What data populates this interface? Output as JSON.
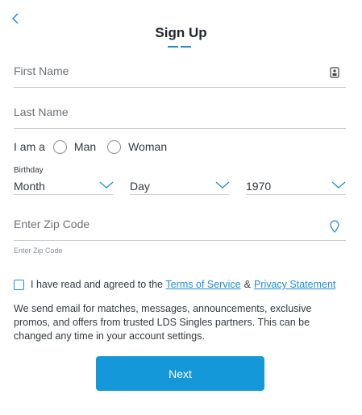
{
  "header": {
    "title": "Sign Up",
    "back_icon": "chevron-left-icon"
  },
  "form": {
    "first_name": {
      "placeholder": "First Name",
      "icon": "contact-card-icon"
    },
    "last_name": {
      "placeholder": "Last Name"
    },
    "gender": {
      "prefix": "I am a",
      "options": [
        "Man",
        "Woman"
      ]
    },
    "birthday": {
      "label": "Birthday",
      "month": "Month",
      "day": "Day",
      "year": "1970"
    },
    "zip": {
      "placeholder": "Enter Zip Code",
      "hint": "Enter Zip Code",
      "icon": "location-pin-icon"
    },
    "terms": {
      "prefix": "I have read and agreed to the",
      "tos": "Terms of Service",
      "amp": "&",
      "privacy": "Privacy Statement"
    },
    "disclaimer": "We send email for matches, messages, announcements, exclusive promos, and offers from trusted LDS Singles partners. This can be changed any time in your account settings.",
    "next_label": "Next"
  },
  "colors": {
    "accent": "#1f8fd6",
    "button": "#1598d9"
  }
}
